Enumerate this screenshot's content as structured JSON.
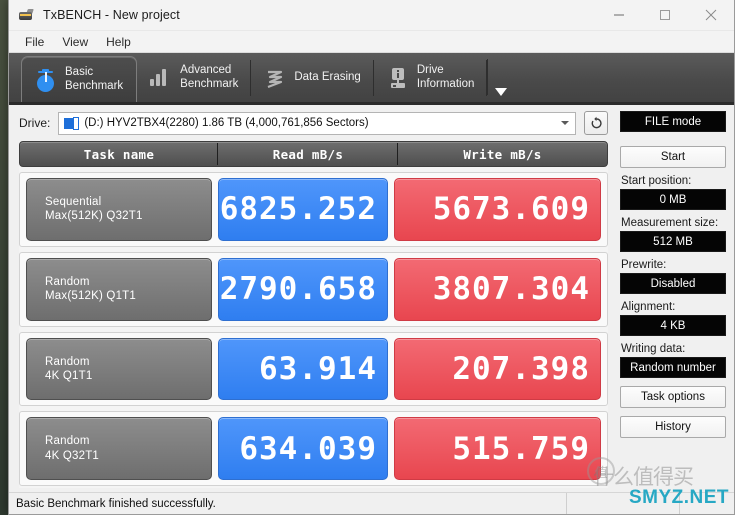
{
  "window": {
    "title": "TxBENCH - New project",
    "app_icon": "usb-drive-icon",
    "controls": {
      "minimize": "minimize-icon",
      "maximize": "maximize-icon",
      "close": "close-icon"
    }
  },
  "menubar": {
    "items": [
      {
        "label": "File"
      },
      {
        "label": "View"
      },
      {
        "label": "Help"
      }
    ]
  },
  "tabs": {
    "items": [
      {
        "line1": "Basic",
        "line2": "Benchmark",
        "icon": "stopwatch-icon",
        "active": true
      },
      {
        "line1": "Advanced",
        "line2": "Benchmark",
        "icon": "bar-chart-icon",
        "active": false
      },
      {
        "line1": "Data Erasing",
        "line2": "",
        "icon": "shredder-icon",
        "active": false
      },
      {
        "line1": "Drive",
        "line2": "Information",
        "icon": "drive-info-icon",
        "active": false
      }
    ],
    "overflow_icon": "chevron-down-icon"
  },
  "drive": {
    "label": "Drive:",
    "selected": "(D:) HYV2TBX4(2280)  1.86 TB (4,000,761,856 Sectors)",
    "dropdown_icon": "chevron-down-icon",
    "drive_icon": "disk-icon",
    "refresh_icon": "refresh-icon"
  },
  "results": {
    "columns": [
      "Task name",
      "Read mB/s",
      "Write mB/s"
    ],
    "rows": [
      {
        "task_line1": "Sequential",
        "task_line2": "Max(512K) Q32T1",
        "read": "6825.252",
        "write": "5673.609"
      },
      {
        "task_line1": "Random",
        "task_line2": "Max(512K) Q1T1",
        "read": "2790.658",
        "write": "3807.304"
      },
      {
        "task_line1": "Random",
        "task_line2": "4K Q1T1",
        "read": "63.914",
        "write": "207.398"
      },
      {
        "task_line1": "Random",
        "task_line2": "4K Q32T1",
        "read": "634.039",
        "write": "515.759"
      }
    ],
    "read_color": "#3b82f6",
    "write_color": "#ea4a54"
  },
  "sidebar": {
    "mode_value": "FILE mode",
    "start_button": "Start",
    "fields": [
      {
        "label": "Start position:",
        "value": "0 MB"
      },
      {
        "label": "Measurement size:",
        "value": "512 MB"
      },
      {
        "label": "Prewrite:",
        "value": "Disabled"
      },
      {
        "label": "Alignment:",
        "value": "4 KB"
      },
      {
        "label": "Writing data:",
        "value": "Random number"
      }
    ],
    "task_options_button": "Task options",
    "history_button": "History"
  },
  "statusbar": {
    "message": "Basic Benchmark finished successfully.",
    "pane2": "",
    "pane3": ""
  },
  "watermark": {
    "cjk": "什么值得买",
    "badge": "值",
    "site": "SMYZ.NET",
    "color": "#27a8c4"
  }
}
